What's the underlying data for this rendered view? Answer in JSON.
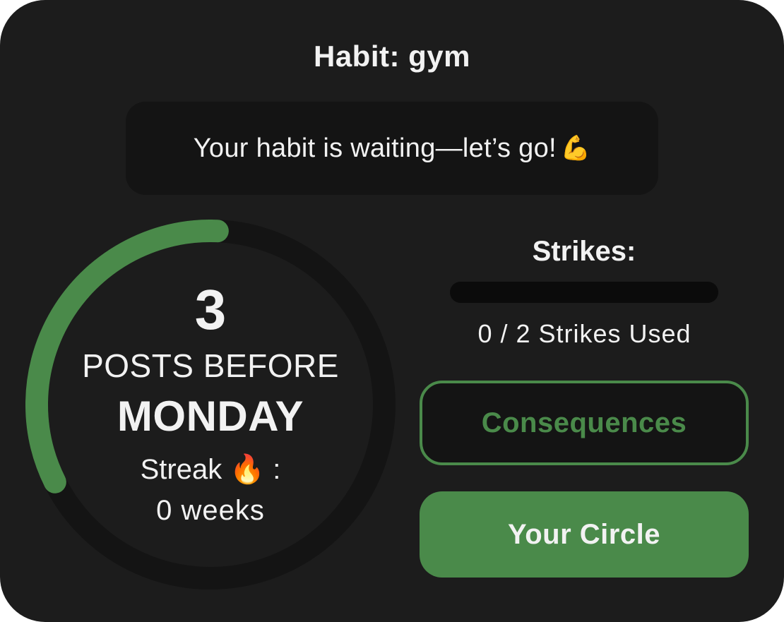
{
  "habit": {
    "title": "Habit: gym"
  },
  "message": {
    "text": "Your habit is waiting—let’s go!",
    "emoji": "💪"
  },
  "progress": {
    "count": "3",
    "label": "POSTS BEFORE",
    "day": "MONDAY",
    "streak_label": "Streak 🔥 :",
    "streak_value": "0 weeks",
    "fraction_complete": 0.33
  },
  "strikes": {
    "title": "Strikes:",
    "used": 0,
    "total": 2,
    "text": "0 / 2 Strikes Used"
  },
  "buttons": {
    "consequences": "Consequences",
    "circle": "Your Circle"
  },
  "colors": {
    "background": "#1c1c1c",
    "panel": "#141414",
    "accent": "#4a8a4a",
    "ring_track": "#141414",
    "text": "#f2f2f2"
  }
}
